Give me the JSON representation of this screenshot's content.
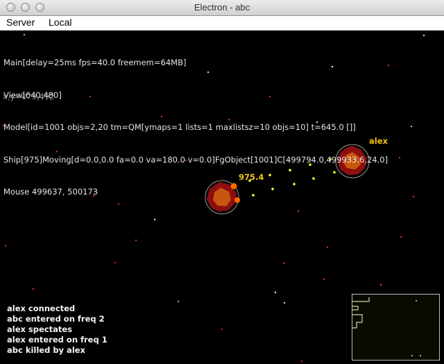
{
  "window": {
    "title": "Electron - abc"
  },
  "menu": {
    "items": [
      "Server",
      "Local"
    ]
  },
  "hud": {
    "lines": [
      "Main[delay=25ms fps=40.0 freemem=64MB]",
      "View[640,480]",
      "Model[id=1001 objs=2,20 tm=QM[ymaps=1 lists=1 maxlistsz=10 objs=10] t=645.0 []]",
      "Ship[975]Moving[d=0.0,0.0 fa=0.0 va=180.0 v=0.0]FgObject[1001]C[499794.0,499933.6,24.0]",
      "Mouse 499637, 500173"
    ],
    "cursor_coords": "x,y=479,492"
  },
  "ships": {
    "enemy_name": "alex",
    "player_distance": "975.4"
  },
  "chat": {
    "messages": [
      "alex connected",
      "abc entered on freq 2",
      "alex spectates",
      "alex entered on freq 1",
      "abc killed by alex"
    ]
  },
  "colors": {
    "background": "#000000",
    "hud_text": "#e6e6e6",
    "label_yellow": "#f3c21a",
    "ship_red": "#8c0f0f",
    "ship_core": "#c8560e",
    "bullet_yellow": "#ffff33",
    "minimap_border": "#bdbdbd"
  }
}
